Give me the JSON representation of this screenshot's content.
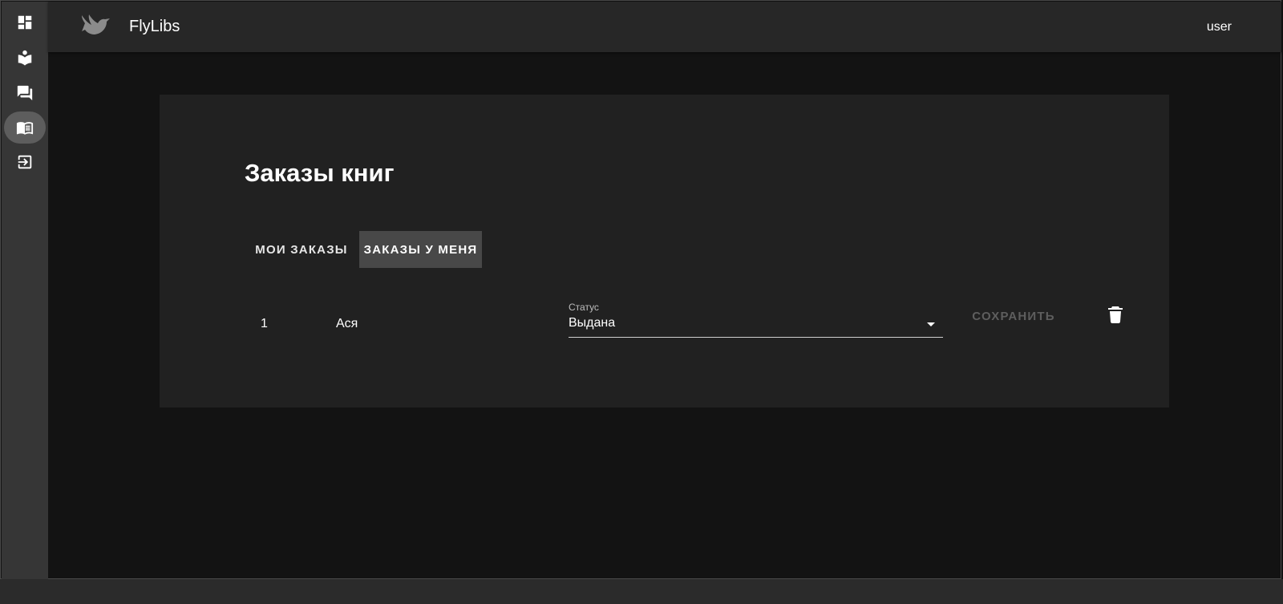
{
  "app": {
    "title": "FlyLibs",
    "user": "user"
  },
  "sidebar": {
    "items": [
      {
        "icon": "dashboard-icon"
      },
      {
        "icon": "book-reader-icon"
      },
      {
        "icon": "forum-icon"
      },
      {
        "icon": "book-open-icon",
        "active": true
      },
      {
        "icon": "logout-icon"
      }
    ]
  },
  "page": {
    "title": "Заказы книг",
    "tabs": [
      {
        "label": "Мои заказы",
        "active": false
      },
      {
        "label": "Заказы у меня",
        "active": true
      }
    ]
  },
  "orders": [
    {
      "number": "1",
      "name": "Ася",
      "status_label": "Статус",
      "status_value": "Выдана",
      "save_label": "Сохранить"
    }
  ],
  "colors": {
    "background": "#121212",
    "card": "#212121",
    "appbar": "#272727",
    "sidebar": "#363636",
    "active_tab": "#484848",
    "disabled_text": "#5e5e5e"
  }
}
